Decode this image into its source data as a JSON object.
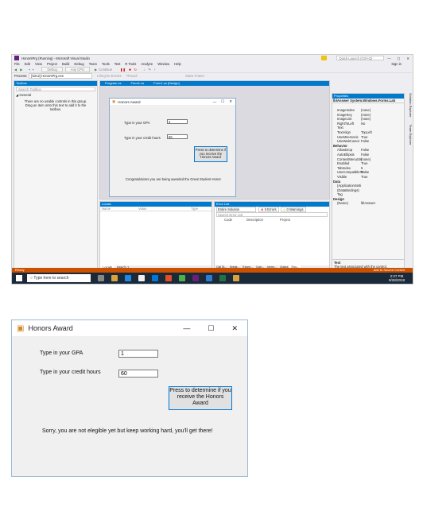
{
  "vs": {
    "title": "HonorsPrg (Running) - Microsoft Visual Studio",
    "quick_launch": "Quick Launch (Ctrl+Q)",
    "sign_in": "Sign in",
    "menu": [
      "File",
      "Edit",
      "View",
      "Project",
      "Build",
      "Debug",
      "Team",
      "Tools",
      "Test",
      "R Tools",
      "Analyze",
      "Window",
      "Help"
    ],
    "toolbar": {
      "debug_config": "Debug",
      "platform": "Any CPU",
      "continue": "Continue"
    },
    "process_label": "Process:",
    "process_value": "[5312] HonorsPrg.exe",
    "lifecycle": "Lifecycle Events",
    "thread": "Thread:",
    "stack_frame": "Stack Frame:",
    "toolbox": {
      "title": "Toolbox",
      "search": "Search Toolbox",
      "general": "◢ General",
      "empty_msg": "There are no usable controls in this group. Drag an item onto this text to add it to the toolbox."
    },
    "tabs": [
      "Program.cs",
      "Form1.cs",
      "Form1.cs [Design]"
    ],
    "small_form": {
      "title": "Honors Award",
      "gpa_label": "Type in your GPA",
      "gpa_value": "3",
      "hours_label": "Type in your credit hours",
      "hours_value": "65",
      "button": "Press to determine if you receive the Honors Award",
      "result": "Congratulations you are being awarded the Great Student Honor"
    },
    "locals": {
      "title": "Locals",
      "cols": [
        "Name",
        "Value",
        "Type"
      ],
      "tabs": [
        "Locals",
        "Watch 1"
      ]
    },
    "error_list": {
      "title": "Error List",
      "scope": "Entire Solution",
      "errors": "0 Errors",
      "warnings": "0 Warnings",
      "search": "Search Error List",
      "cols": [
        "Code",
        "Description",
        "Project"
      ],
      "tabs": [
        "Call St...",
        "Break...",
        "Excep...",
        "Com...",
        "Imme...",
        "Output",
        "Erro..."
      ]
    },
    "properties": {
      "title": "Properties",
      "object": "lblAnswer  System.Windows.Forms.Lab",
      "rows": [
        [
          "ImageIndex",
          "(none)"
        ],
        [
          "ImageKey",
          "(none)"
        ],
        [
          "ImageList",
          "(none)"
        ],
        [
          "RightToLeft",
          "No"
        ],
        [
          "Text",
          ""
        ],
        [
          "TextAlign",
          "TopLeft"
        ],
        [
          "UseMnemonic",
          "True"
        ],
        [
          "UseWaitCursor",
          "False"
        ]
      ],
      "behavior": "Behavior",
      "behavior_rows": [
        [
          "AllowDrop",
          "False"
        ],
        [
          "AutoEllipsis",
          "False"
        ],
        [
          "ContextMenuStri",
          "(none)"
        ],
        [
          "Enabled",
          "True"
        ],
        [
          "TabIndex",
          "5"
        ],
        [
          "UseCompatibleTe",
          "False"
        ],
        [
          "Visible",
          "True"
        ]
      ],
      "data": "Data",
      "data_rows": [
        [
          "(ApplicationSetti",
          ""
        ],
        [
          "(DataBindings)",
          ""
        ],
        [
          "Tag",
          ""
        ]
      ],
      "design": "Design",
      "design_rows": [
        [
          "(Name)",
          "lblAnswer"
        ]
      ],
      "desc_title": "Text",
      "desc": "The text associated with the control."
    },
    "side_tabs": [
      "Solution Explorer",
      "Team Explorer"
    ],
    "status": {
      "left": "Ready",
      "right": "Add to Source Control"
    },
    "taskbar": {
      "search": "Type here to search",
      "time": "2:27 PM",
      "date": "9/28/2018"
    }
  },
  "form": {
    "title": "Honors Award",
    "gpa_label": "Type in your GPA",
    "gpa_value": "1",
    "hours_label": "Type in your credit hours",
    "hours_value": "60",
    "button": "Press to determine if you receive the Honors Award",
    "result": "Sorry, you are not elegible yet but keep working hard, you'll get there!",
    "min": "—",
    "max": "☐",
    "close": "✕"
  },
  "colors": {
    "accent": "#007acc",
    "status": "#ca5100",
    "taskbar": "#1b2a3a",
    "button_border": "#0078d7"
  }
}
